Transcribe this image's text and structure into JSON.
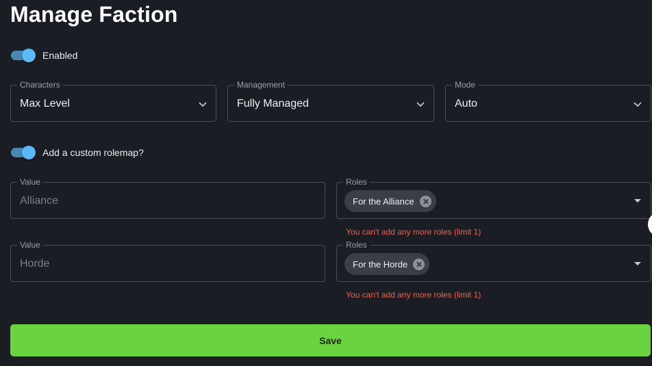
{
  "page": {
    "title": "Manage Faction"
  },
  "enabled_toggle": {
    "label": "Enabled",
    "on": true
  },
  "selects": {
    "characters": {
      "label": "Characters",
      "value": "Max Level"
    },
    "management": {
      "label": "Management",
      "value": "Fully Managed"
    },
    "mode": {
      "label": "Mode",
      "value": "Auto"
    }
  },
  "rolemap_toggle": {
    "label": "Add a custom rolemap?",
    "on": true
  },
  "rolemap": [
    {
      "value_label": "Value",
      "value_placeholder": "Alliance",
      "roles_label": "Roles",
      "role_chip": "For the Alliance",
      "error": "You can't add any more roles (limit 1)"
    },
    {
      "value_label": "Value",
      "value_placeholder": "Horde",
      "roles_label": "Roles",
      "role_chip": "For the Horde",
      "error": "You can't add any more roles (limit 1)"
    }
  ],
  "save_button": {
    "label": "Save"
  },
  "colors": {
    "background": "#1a1d24",
    "toggle_on": "#5bb9f5",
    "save": "#6cd340",
    "error": "#f0614f"
  }
}
